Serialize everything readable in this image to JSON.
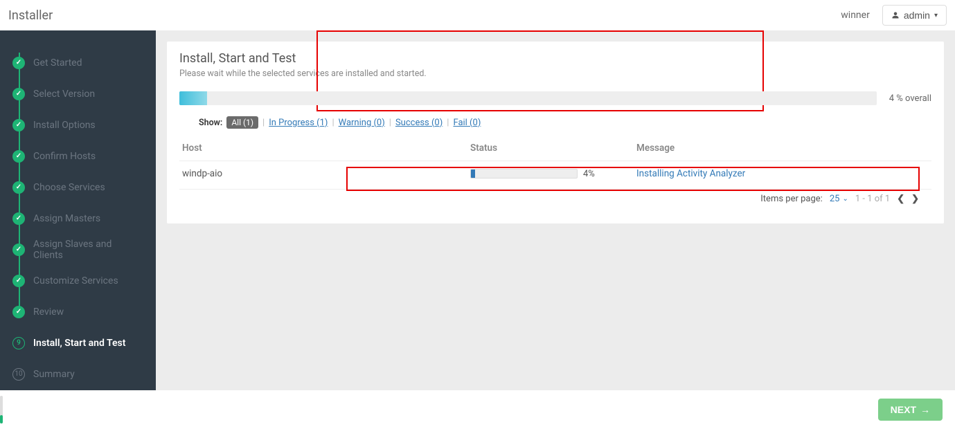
{
  "header": {
    "title": "Installer",
    "cluster": "winner",
    "user": "admin"
  },
  "steps": [
    {
      "label": "Get Started",
      "state": "done"
    },
    {
      "label": "Select Version",
      "state": "done"
    },
    {
      "label": "Install Options",
      "state": "done"
    },
    {
      "label": "Confirm Hosts",
      "state": "done"
    },
    {
      "label": "Choose Services",
      "state": "done"
    },
    {
      "label": "Assign Masters",
      "state": "done"
    },
    {
      "label": "Assign Slaves and Clients",
      "state": "done"
    },
    {
      "label": "Customize Services",
      "state": "done"
    },
    {
      "label": "Review",
      "state": "done"
    },
    {
      "label": "Install, Start and Test",
      "state": "active",
      "num": "9"
    },
    {
      "label": "Summary",
      "state": "pending",
      "num": "10"
    }
  ],
  "panel": {
    "title": "Install, Start and Test",
    "sub": "Please wait while the selected services are installed and started.",
    "overall_pct": 4,
    "overall_label": "4 % overall"
  },
  "filters": {
    "show_label": "Show:",
    "all": "All (1)",
    "in_progress": "In Progress (1)",
    "warning": "Warning (0)",
    "success": "Success (0)",
    "fail": "Fail (0)"
  },
  "table": {
    "headers": {
      "host": "Host",
      "status": "Status",
      "message": "Message"
    },
    "rows": [
      {
        "host": "windp-aio",
        "pct": 4,
        "pct_label": "4%",
        "message": "Installing Activity Analyzer"
      }
    ]
  },
  "pager": {
    "items_label": "Items per page:",
    "per_page": "25",
    "range": "1 - 1 of 1"
  },
  "footer": {
    "next": "NEXT"
  }
}
